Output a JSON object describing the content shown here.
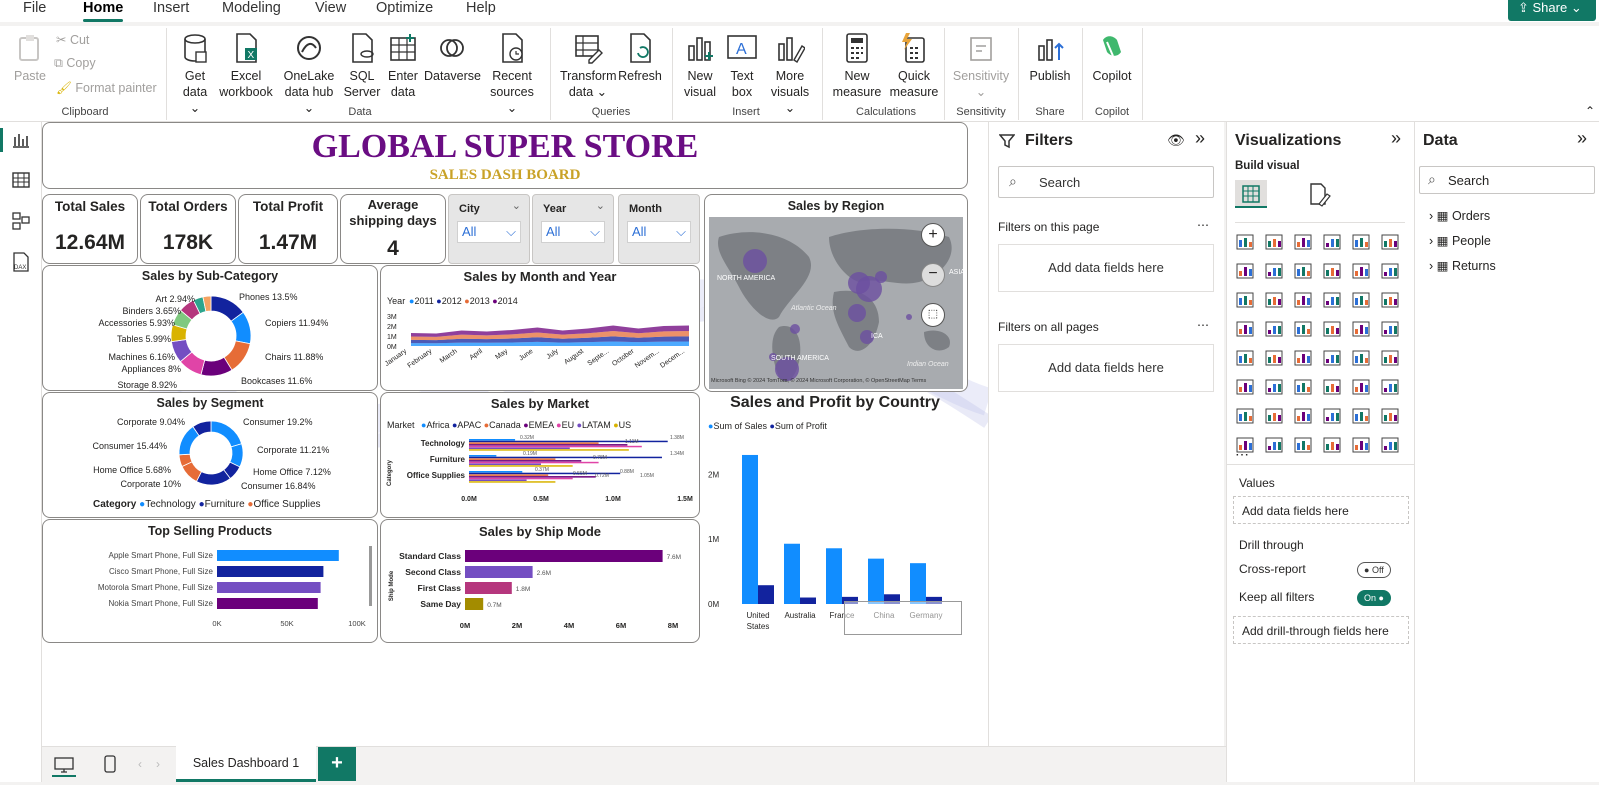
{
  "menu": [
    "File",
    "Home",
    "Insert",
    "Modeling",
    "View",
    "Optimize",
    "Help"
  ],
  "share_label": "Share",
  "ribbon": {
    "paste": "Paste",
    "cut": "Cut",
    "copy": "Copy",
    "format_painter": "Format painter",
    "get_data": [
      "Get",
      "data"
    ],
    "excel": [
      "Excel",
      "workbook"
    ],
    "onelake": [
      "OneLake",
      "data hub"
    ],
    "sql": [
      "SQL",
      "Server"
    ],
    "enter": [
      "Enter",
      "data"
    ],
    "dataverse": "Dataverse",
    "recent": [
      "Recent",
      "sources"
    ],
    "transform": [
      "Transform",
      "data"
    ],
    "refresh": "Refresh",
    "new_visual": [
      "New",
      "visual"
    ],
    "text_box": [
      "Text",
      "box"
    ],
    "more_visuals": [
      "More",
      "visuals"
    ],
    "new_measure": [
      "New",
      "measure"
    ],
    "quick_measure": [
      "Quick",
      "measure"
    ],
    "sensitivity": "Sensitivity",
    "publish": "Publish",
    "copilot": "Copilot",
    "groups": {
      "clipboard": "Clipboard",
      "data": "Data",
      "queries": "Queries",
      "insert": "Insert",
      "calculations": "Calculations",
      "sensitivity": "Sensitivity",
      "share": "Share",
      "copilot": "Copilot"
    }
  },
  "report": {
    "title": "GLOBAL SUPER STORE",
    "subtitle": "SALES DASH BOARD",
    "kpis": [
      {
        "label": "Total Sales",
        "value": "12.64M"
      },
      {
        "label": "Total Orders",
        "value": "178K"
      },
      {
        "label": "Total Profit",
        "value": "1.47M"
      },
      {
        "label": "Average shipping days",
        "value": "4"
      }
    ],
    "slicers": [
      {
        "label": "City",
        "value": "All"
      },
      {
        "label": "Year",
        "value": "All"
      },
      {
        "label": "Month",
        "value": "All"
      }
    ],
    "region_title": "Sales by Region",
    "map_labels": {
      "na": "NORTH AMERICA",
      "sa": "SOUTH AMERICA",
      "atlantic": "Atlantic Ocean",
      "indian": "Indian Ocean",
      "asia": "ASIA",
      "africa": "ICA"
    },
    "map_footer": "Microsoft Bing  © 2024 TomTom, © 2024 Microsoft Corporation, © OpenStreetMap  Terms"
  },
  "colors": {
    "accent": "#117865",
    "title": "#6a0d83",
    "subtitle": "#c9a227",
    "blue": "#118dff",
    "navy": "#12239e",
    "orange": "#e66c37",
    "purple": "#6b007b",
    "magenta": "#e044a7",
    "violet": "#744ec2",
    "gold": "#d9b300",
    "pinkish": "#b5367d"
  },
  "chart_data": [
    {
      "name": "Sales by Sub-Category",
      "type": "pie",
      "labels": [
        "Phones",
        "Copiers",
        "Chairs",
        "Bookcases",
        "Storage",
        "Appliances",
        "Machines",
        "Tables",
        "Accessories",
        "Binders",
        "Art"
      ],
      "values": [
        13.5,
        11.94,
        11.88,
        11.6,
        8.92,
        8,
        6.16,
        5.99,
        5.93,
        3.65,
        2.94
      ],
      "label_text": [
        "Phones 13.5%",
        "Copiers 11.94%",
        "Chairs 11.88%",
        "Bookcases 11.6%",
        "Storage 8.92%",
        "Appliances 8%",
        "Machines 6.16%",
        "Tables 5.99%",
        "Accessories 5.93%",
        "Binders 3.65%",
        "Art 2.94%"
      ]
    },
    {
      "name": "Sales by Month and Year",
      "type": "area",
      "legend_title": "Year",
      "series": [
        {
          "name": "2011"
        },
        {
          "name": "2012"
        },
        {
          "name": "2013"
        },
        {
          "name": "2014"
        }
      ],
      "categories": [
        "January",
        "February",
        "March",
        "April",
        "May",
        "June",
        "July",
        "August",
        "Septe...",
        "October",
        "Novem...",
        "Decem..."
      ],
      "y_ticks": [
        "0M",
        "1M",
        "2M",
        "3M"
      ],
      "totals": [
        1.3,
        1.25,
        1.55,
        1.45,
        1.6,
        1.85,
        1.55,
        1.75,
        2.05,
        1.75,
        2.0,
        2.05
      ]
    },
    {
      "name": "Sales by Segment",
      "type": "pie",
      "labels": [
        "Consumer",
        "Corporate",
        "Home Office",
        "Consumer",
        "Corporate",
        "Home Office",
        "Corporate",
        "Consumer"
      ],
      "label_text": [
        "Corporate 9.04%",
        "Consumer 19.2%",
        "Consumer 15.44%",
        "Corporate 11.21%",
        "Home Office 5.68%",
        "Home Office 7.12%",
        "Corporate 10%",
        "Consumer 16.84%"
      ],
      "values": [
        19.2,
        11.21,
        7.12,
        16.84,
        10,
        5.68,
        15.44,
        9.04
      ],
      "legend_title": "Category",
      "legend": [
        "Technology",
        "Furniture",
        "Office Supplies"
      ]
    },
    {
      "name": "Sales by Market",
      "type": "bar",
      "orientation": "horizontal",
      "legend_title": "Market",
      "series": [
        {
          "name": "Africa"
        },
        {
          "name": "APAC"
        },
        {
          "name": "Canada"
        },
        {
          "name": "EMEA"
        },
        {
          "name": "EU"
        },
        {
          "name": "LATAM"
        },
        {
          "name": "US"
        }
      ],
      "categories": [
        "Technology",
        "Furniture",
        "Office Supplies"
      ],
      "x_ticks": [
        "0.0M",
        "0.5M",
        "1.0M",
        "1.5M"
      ],
      "data_labels": [
        "0.32M",
        "1.38M",
        "1.11M",
        "1.34M",
        "0.78M",
        "0.88M",
        "1.05M",
        "0.19M",
        "0.72M",
        "0.37M",
        "0.55M"
      ]
    },
    {
      "name": "Top Selling Products",
      "type": "bar",
      "orientation": "horizontal",
      "categories": [
        "Apple Smart Phone, Full Size",
        "Cisco Smart Phone, Full Size",
        "Motorola Smart Phone, Full Size",
        "Nokia Smart Phone, Full Size"
      ],
      "values": [
        87000,
        76000,
        74000,
        72000
      ],
      "x_ticks": [
        "0K",
        "50K",
        "100K"
      ],
      "xlim": [
        0,
        100000
      ]
    },
    {
      "name": "Sales by Ship Mode",
      "type": "bar",
      "orientation": "horizontal",
      "ylabel": "Ship Mode",
      "categories": [
        "Standard Class",
        "Second Class",
        "First Class",
        "Same Day"
      ],
      "values": [
        7.6,
        2.6,
        1.8,
        0.7
      ],
      "data_labels": [
        "7.6M",
        "2.6M",
        "1.8M",
        "0.7M"
      ],
      "x_ticks": [
        "0M",
        "2M",
        "4M",
        "6M",
        "8M"
      ],
      "xlim": [
        0,
        8
      ]
    },
    {
      "name": "Sales and Profit by Country",
      "type": "bar",
      "categories": [
        "United States",
        "Australia",
        "France",
        "China",
        "Germany"
      ],
      "series": [
        {
          "name": "Sum of Sales",
          "values": [
            2.3,
            0.93,
            0.86,
            0.7,
            0.63
          ]
        },
        {
          "name": "Sum of Profit",
          "values": [
            0.29,
            0.1,
            0.11,
            0.15,
            0.11
          ]
        }
      ],
      "y_ticks": [
        "0M",
        "1M",
        "2M"
      ],
      "ylim": [
        0,
        2.5
      ]
    }
  ],
  "filters": {
    "title": "Filters",
    "search": "Search",
    "on_page": "Filters on this page",
    "on_all": "Filters on all pages",
    "add": "Add data fields here"
  },
  "viz": {
    "title": "Visualizations",
    "build": "Build visual",
    "values": "Values",
    "add": "Add data fields here",
    "drill": "Drill through",
    "cross": "Cross-report",
    "cross_state": "Off",
    "keep": "Keep all filters",
    "keep_state": "On",
    "add_drill": "Add drill-through fields here"
  },
  "data_pane": {
    "title": "Data",
    "search": "Search",
    "tables": [
      "Orders",
      "People",
      "Returns"
    ]
  },
  "tab": {
    "name": "Sales Dashboard 1"
  }
}
